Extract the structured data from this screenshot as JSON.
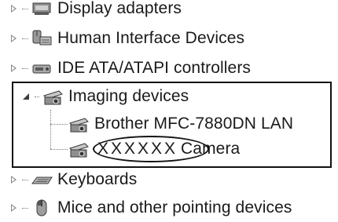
{
  "device_tree": {
    "items": [
      {
        "label": "Display adapters",
        "icon": "display-adapter-icon",
        "state": "collapsed"
      },
      {
        "label": "Human Interface Devices",
        "icon": "hid-icon",
        "state": "collapsed"
      },
      {
        "label": "IDE ATA/ATAPI controllers",
        "icon": "ide-controller-icon",
        "state": "collapsed"
      },
      {
        "label": "Imaging devices",
        "icon": "imaging-device-icon",
        "state": "expanded",
        "children": [
          {
            "label": "Brother MFC-7880DN LAN",
            "icon": "scanner-icon"
          },
          {
            "masked_name": "XXXXXX",
            "label": "Camera",
            "icon": "scanner-icon"
          }
        ]
      },
      {
        "label": "Keyboards",
        "icon": "keyboard-icon",
        "state": "collapsed"
      },
      {
        "label": "Mice and other pointing devices",
        "icon": "mouse-icon",
        "state": "collapsed"
      }
    ]
  }
}
